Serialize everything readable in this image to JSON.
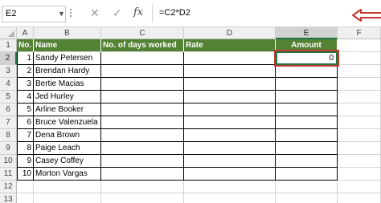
{
  "formula_bar": {
    "name_box": "E2",
    "cancel_icon": "✕",
    "enter_icon": "✓",
    "fx_label": "fx",
    "formula": "=C2*D2"
  },
  "columns": [
    "A",
    "B",
    "C",
    "D",
    "E",
    "F"
  ],
  "active_column": "E",
  "active_row": 2,
  "row_numbers": [
    "1",
    "2",
    "3",
    "4",
    "5",
    "6",
    "7",
    "8",
    "9",
    "10",
    "11",
    "12",
    "13"
  ],
  "table_headers": [
    "No.",
    "Name",
    "No. of days worked",
    "Rate",
    "Amount"
  ],
  "rows": [
    {
      "no": "1",
      "name": "Sandy Petersen",
      "amount": "0"
    },
    {
      "no": "2",
      "name": "Brendan Hardy",
      "amount": ""
    },
    {
      "no": "3",
      "name": "Bertie Macias",
      "amount": ""
    },
    {
      "no": "4",
      "name": "Jed Hurley",
      "amount": ""
    },
    {
      "no": "5",
      "name": "Arline Booker",
      "amount": ""
    },
    {
      "no": "6",
      "name": "Bruce Valenzuela",
      "amount": ""
    },
    {
      "no": "7",
      "name": "Dena Brown",
      "amount": ""
    },
    {
      "no": "8",
      "name": "Paige Leach",
      "amount": ""
    },
    {
      "no": "9",
      "name": "Casey Coffey",
      "amount": ""
    },
    {
      "no": "10",
      "name": "Morton Vargas",
      "amount": ""
    }
  ],
  "colors": {
    "header_fill": "#548235",
    "selection": "#217346",
    "annotation": "#c0392b"
  }
}
